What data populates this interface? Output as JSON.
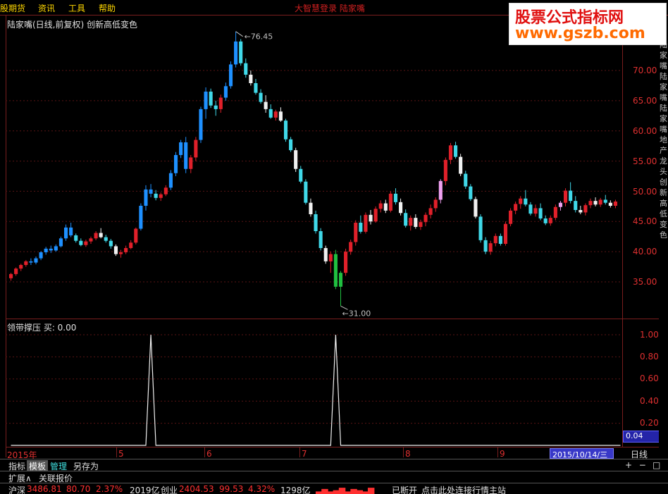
{
  "menu": {
    "items": [
      "股期货",
      "资讯",
      "工具",
      "帮助"
    ],
    "center_text": "大智慧登录 陆家嘴"
  },
  "watermark": {
    "cn": "股票公式指标网",
    "url": "www.gszb.com"
  },
  "chart": {
    "title": "陆家嘴(日线,前复权) 创新高低变色",
    "max_label": "76.45",
    "min_label": "31.00",
    "y_ticks": [
      "70.00",
      "65.00",
      "60.00",
      "55.00",
      "50.00",
      "45.00",
      "40.00",
      "35.00"
    ],
    "side_text": "陆家嘴陆家嘴陆家嘴地产龙头创新高低变色"
  },
  "indicator": {
    "title": "领带撑压 买: 0.00",
    "y_ticks": [
      "1.00",
      "0.80",
      "0.60",
      "0.40",
      "0.20"
    ],
    "current_value": "0.04"
  },
  "dates": {
    "labels": [
      "2015年",
      "5",
      "6",
      "7",
      "8",
      "9"
    ],
    "cursor": "2015/10/14/三",
    "period": "日线"
  },
  "tabs": {
    "items": [
      "指标",
      "模板",
      "管理",
      "另存为"
    ],
    "active": "模板"
  },
  "subtabs": {
    "items": [
      "扩展∧",
      "关联报价"
    ]
  },
  "zoom": {
    "plus": "+",
    "minus": "−",
    "box": "□"
  },
  "status": {
    "sh_name": "沪深",
    "sh_value": "3486.81",
    "sh_change": "80.70",
    "sh_pct": "2.37%",
    "sh_amount": "2019亿",
    "cy_name": "创业",
    "cy_value": "2404.53",
    "cy_change": "99.53",
    "cy_pct": "4.32%",
    "cy_amount": "1298亿",
    "conn": "已断开",
    "hint": "点击此处连接行情主站"
  },
  "chart_data": {
    "type": "candlestick",
    "x_start_label": "2015年",
    "y_range": [
      31.0,
      76.45
    ],
    "ohlc": [
      [
        35.6,
        36.5,
        35.2,
        36.3
      ],
      [
        36.3,
        37.4,
        36.0,
        37.2
      ],
      [
        37.2,
        38.0,
        36.8,
        37.8
      ],
      [
        37.8,
        38.6,
        37.5,
        38.4
      ],
      [
        38.4,
        38.9,
        37.8,
        38.2
      ],
      [
        38.2,
        39.2,
        37.9,
        38.9
      ],
      [
        38.9,
        40.1,
        38.6,
        39.9
      ],
      [
        39.9,
        40.8,
        39.5,
        40.5
      ],
      [
        40.5,
        41.0,
        39.8,
        40.2
      ],
      [
        40.2,
        41.2,
        40.0,
        40.9
      ],
      [
        40.9,
        42.5,
        40.7,
        42.2
      ],
      [
        42.2,
        44.5,
        41.8,
        44.0
      ],
      [
        44.0,
        44.8,
        42.4,
        42.7
      ],
      [
        42.7,
        43.0,
        41.5,
        41.8
      ],
      [
        41.8,
        42.2,
        40.9,
        41.1
      ],
      [
        41.1,
        42.0,
        40.8,
        41.7
      ],
      [
        41.7,
        42.5,
        41.3,
        42.2
      ],
      [
        42.2,
        43.4,
        41.9,
        43.1
      ],
      [
        43.1,
        43.9,
        42.2,
        42.4
      ],
      [
        42.4,
        42.8,
        41.5,
        41.8
      ],
      [
        41.8,
        42.1,
        40.5,
        40.9
      ],
      [
        40.9,
        41.2,
        39.3,
        39.6
      ],
      [
        39.6,
        40.3,
        39.0,
        39.9
      ],
      [
        39.9,
        41.0,
        39.6,
        40.6
      ],
      [
        40.6,
        41.9,
        40.4,
        41.5
      ],
      [
        41.5,
        44.0,
        41.2,
        43.8
      ],
      [
        43.8,
        48.0,
        43.5,
        47.6
      ],
      [
        47.6,
        51.0,
        46.8,
        50.3
      ],
      [
        50.3,
        51.2,
        49.0,
        49.6
      ],
      [
        49.6,
        50.2,
        48.5,
        48.9
      ],
      [
        48.9,
        49.8,
        48.4,
        49.5
      ],
      [
        49.5,
        51.0,
        49.2,
        50.6
      ],
      [
        50.6,
        53.5,
        50.2,
        53.0
      ],
      [
        53.0,
        56.5,
        52.5,
        56.0
      ],
      [
        56.0,
        58.5,
        55.5,
        58.1
      ],
      [
        58.1,
        59.0,
        53.0,
        53.7
      ],
      [
        53.7,
        56.0,
        53.0,
        55.6
      ],
      [
        55.6,
        59.0,
        55.0,
        58.5
      ],
      [
        58.5,
        64.0,
        58.0,
        63.6
      ],
      [
        63.6,
        67.2,
        62.0,
        66.5
      ],
      [
        66.5,
        67.0,
        63.8,
        64.2
      ],
      [
        64.2,
        65.0,
        62.5,
        63.6
      ],
      [
        63.6,
        66.0,
        63.0,
        65.5
      ],
      [
        65.5,
        68.0,
        65.0,
        67.4
      ],
      [
        67.4,
        71.5,
        67.0,
        71.0
      ],
      [
        71.0,
        76.45,
        70.5,
        74.8
      ],
      [
        74.8,
        75.2,
        70.8,
        71.2
      ],
      [
        71.2,
        72.0,
        68.8,
        69.3
      ],
      [
        69.3,
        70.0,
        67.5,
        67.9
      ],
      [
        67.9,
        68.6,
        66.0,
        66.3
      ],
      [
        66.3,
        66.9,
        64.5,
        64.8
      ],
      [
        64.8,
        65.9,
        63.0,
        63.6
      ],
      [
        63.6,
        64.4,
        62.0,
        62.2
      ],
      [
        62.2,
        63.5,
        61.7,
        63.2
      ],
      [
        63.2,
        63.9,
        61.5,
        61.7
      ],
      [
        61.7,
        62.0,
        58.2,
        58.6
      ],
      [
        58.6,
        59.0,
        56.5,
        56.8
      ],
      [
        56.8,
        57.2,
        53.2,
        53.7
      ],
      [
        53.7,
        54.2,
        51.3,
        51.6
      ],
      [
        51.6,
        52.0,
        47.8,
        48.1
      ],
      [
        48.1,
        48.8,
        45.8,
        46.2
      ],
      [
        46.2,
        46.8,
        43.0,
        43.4
      ],
      [
        43.4,
        43.9,
        40.2,
        40.6
      ],
      [
        40.6,
        41.0,
        38.0,
        38.4
      ],
      [
        38.4,
        40.0,
        36.5,
        39.6
      ],
      [
        39.6,
        40.3,
        33.8,
        34.2
      ],
      [
        34.2,
        36.8,
        31.0,
        36.5
      ],
      [
        36.5,
        40.5,
        36.0,
        40.0
      ],
      [
        40.0,
        42.0,
        39.5,
        41.6
      ],
      [
        41.6,
        45.2,
        41.0,
        44.8
      ],
      [
        44.8,
        46.0,
        43.0,
        43.3
      ],
      [
        43.3,
        46.5,
        43.0,
        46.1
      ],
      [
        46.1,
        46.9,
        44.5,
        45.0
      ],
      [
        45.0,
        47.5,
        44.8,
        47.1
      ],
      [
        47.1,
        48.5,
        46.5,
        48.0
      ],
      [
        48.0,
        48.6,
        46.4,
        46.8
      ],
      [
        46.8,
        50.0,
        46.5,
        49.6
      ],
      [
        49.6,
        50.5,
        47.8,
        48.2
      ],
      [
        48.2,
        48.8,
        46.0,
        46.4
      ],
      [
        46.4,
        47.0,
        44.0,
        44.3
      ],
      [
        44.3,
        46.0,
        43.5,
        45.6
      ],
      [
        45.6,
        46.2,
        43.8,
        44.1
      ],
      [
        44.1,
        45.3,
        43.6,
        44.9
      ],
      [
        44.9,
        46.5,
        44.2,
        46.1
      ],
      [
        46.1,
        47.8,
        45.5,
        47.2
      ],
      [
        47.2,
        49.0,
        46.6,
        48.6
      ],
      [
        48.6,
        52.0,
        48.0,
        51.7
      ],
      [
        51.7,
        55.6,
        51.0,
        55.2
      ],
      [
        55.2,
        58.0,
        54.5,
        57.6
      ],
      [
        57.6,
        58.2,
        55.4,
        55.7
      ],
      [
        55.7,
        56.2,
        52.5,
        52.9
      ],
      [
        52.9,
        53.4,
        50.4,
        50.8
      ],
      [
        50.8,
        51.2,
        48.4,
        48.7
      ],
      [
        48.7,
        49.1,
        45.5,
        45.8
      ],
      [
        45.8,
        46.2,
        41.5,
        41.9
      ],
      [
        41.9,
        42.4,
        39.6,
        40.0
      ],
      [
        40.0,
        41.8,
        39.5,
        41.4
      ],
      [
        41.4,
        43.0,
        40.9,
        42.6
      ],
      [
        42.6,
        43.0,
        41.0,
        41.3
      ],
      [
        41.3,
        45.0,
        41.0,
        44.6
      ],
      [
        44.6,
        47.2,
        44.2,
        46.8
      ],
      [
        46.8,
        48.3,
        46.2,
        47.9
      ],
      [
        47.9,
        49.2,
        47.1,
        48.8
      ],
      [
        48.8,
        50.2,
        47.5,
        47.8
      ],
      [
        47.8,
        48.2,
        46.0,
        46.3
      ],
      [
        46.3,
        47.8,
        45.8,
        47.2
      ],
      [
        47.2,
        48.0,
        45.2,
        45.5
      ],
      [
        45.5,
        46.0,
        44.4,
        44.7
      ],
      [
        44.7,
        46.0,
        44.3,
        45.6
      ],
      [
        45.6,
        47.8,
        45.2,
        47.4
      ],
      [
        47.4,
        48.4,
        46.8,
        48.1
      ],
      [
        48.1,
        50.5,
        47.5,
        50.1
      ],
      [
        50.1,
        51.5,
        48.0,
        48.4
      ],
      [
        48.4,
        49.2,
        46.5,
        46.9
      ],
      [
        46.9,
        47.6,
        46.2,
        46.5
      ],
      [
        46.5,
        48.0,
        46.0,
        47.7
      ],
      [
        47.7,
        48.8,
        47.2,
        48.4
      ],
      [
        48.4,
        49.0,
        47.5,
        47.8
      ],
      [
        47.8,
        48.9,
        47.4,
        48.6
      ],
      [
        48.6,
        49.4,
        47.8,
        48.1
      ],
      [
        48.1,
        48.5,
        47.3,
        47.6
      ],
      [
        47.6,
        48.6,
        47.2,
        48.3
      ]
    ],
    "indicator_series": [
      0,
      0,
      0,
      0,
      0,
      0,
      0,
      0,
      0,
      0,
      0,
      0,
      0,
      0,
      0,
      0,
      0,
      0,
      0,
      0,
      0,
      0,
      0,
      0,
      0,
      0,
      0,
      0,
      1,
      0,
      0,
      0,
      0,
      0,
      0,
      0,
      0,
      0,
      0,
      0,
      0,
      0,
      0,
      0,
      0,
      0,
      0,
      0,
      0,
      0,
      0,
      0,
      0,
      0,
      0,
      0,
      0,
      0,
      0,
      0,
      0,
      0,
      0,
      0,
      0,
      1,
      0,
      0,
      0,
      0,
      0,
      0,
      0,
      0,
      0,
      0,
      0,
      0,
      0,
      0,
      0,
      0,
      0,
      0,
      0,
      0,
      0,
      0,
      0,
      0,
      0,
      0,
      0,
      0,
      0,
      0,
      0,
      0,
      0,
      0,
      0,
      0,
      0,
      0,
      0,
      0,
      0,
      0,
      0,
      0,
      0,
      0,
      0,
      0,
      0,
      0,
      0,
      0,
      0,
      0,
      0,
      0,
      0
    ],
    "colors": {
      "up": "#e0202a",
      "down": "#40d8e8",
      "new_high": "#1e90ff",
      "new_low": "#20c040",
      "flat": "#f0f0f0",
      "pink": "#f0a0f0"
    }
  }
}
